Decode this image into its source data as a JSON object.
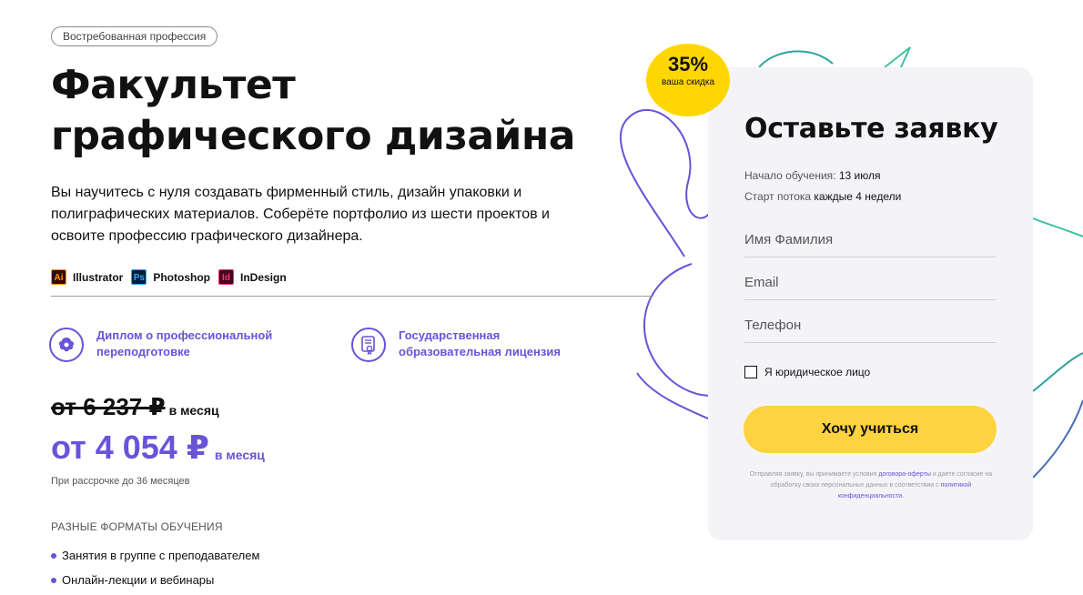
{
  "hero": {
    "tag": "Востребованная профессия",
    "title_line1": "Факультет",
    "title_line2": "графического дизайна",
    "description": "Вы научитесь с нуля создавать фирменный стиль, дизайн упаковки и полиграфических материалов. Соберёте портфолио из шести проектов и освоите профессию графического дизайнера."
  },
  "tools": [
    {
      "icon": "illustrator-icon",
      "abbr": "Ai",
      "label": "Illustrator",
      "color": "#ff9a00"
    },
    {
      "icon": "photoshop-icon",
      "abbr": "Ps",
      "label": "Photoshop",
      "color": "#31a8ff"
    },
    {
      "icon": "indesign-icon",
      "abbr": "Id",
      "label": "InDesign",
      "color": "#ff3366"
    }
  ],
  "features": [
    {
      "icon": "emblem-icon",
      "text": "Диплом о профессиональной переподготовке"
    },
    {
      "icon": "license-certificate-icon",
      "text": "Государственная образовательная лицензия"
    }
  ],
  "pricing": {
    "old_price": "от 6 237 ₽",
    "old_unit": "в месяц",
    "new_price": "от 4 054 ₽",
    "new_unit": "в месяц",
    "installment": "При рассрочке до 36 месяцев"
  },
  "formats": {
    "heading": "РАЗНЫЕ ФОРМАТЫ ОБУЧЕНИЯ",
    "items": [
      "Занятия в группе с преподавателем",
      "Онлайн-лекции и вебинары"
    ]
  },
  "discount_badge": {
    "percent": "35%",
    "caption": "ваша скидка",
    "color": "#ffd600"
  },
  "form": {
    "title": "Оставьте заявку",
    "start_label": "Начало обучения:",
    "start_value": "13 июля",
    "stream_label": "Старт потока",
    "stream_value": "каждые 4 недели",
    "name_placeholder": "Имя Фамилия",
    "email_placeholder": "Email",
    "phone_placeholder": "Телефон",
    "legal_entity_label": "Я юридическое лицо",
    "submit_label": "Хочу учиться",
    "consent_prefix": "Отправляя заявку, вы принимаете условия",
    "consent_offer_link": "договора-оферты",
    "consent_middle": "и даете согласие на обработку своих персональных данных в соответствии с",
    "consent_privacy_link": "политикой конфиденциальности."
  },
  "colors": {
    "accent": "#6a52d9",
    "button": "#ffd23f",
    "form_bg": "#f4f4f8"
  }
}
